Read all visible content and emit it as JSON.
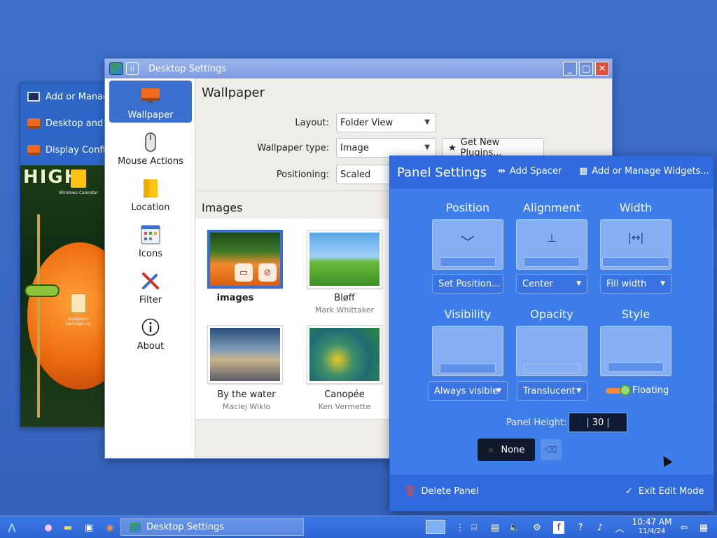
{
  "background_window": {
    "items": [
      {
        "label": "Add or Manage Widgets",
        "icon": "widgets-icon"
      },
      {
        "label": "Desktop and Wallpaper",
        "icon": "monitor-icon"
      },
      {
        "label": "Display Configuration",
        "icon": "monitor-icon"
      }
    ],
    "art_title": "HIGH",
    "desktop_icons": [
      {
        "label": "Windows Calendar"
      },
      {
        "label": "wallpaper package.zip"
      }
    ]
  },
  "desktop_settings": {
    "title": "Desktop Settings",
    "sidebar": [
      {
        "label": "Wallpaper",
        "icon": "monitor-icon",
        "active": true
      },
      {
        "label": "Mouse Actions",
        "icon": "mouse-icon"
      },
      {
        "label": "Location",
        "icon": "folder-icon"
      },
      {
        "label": "Icons",
        "icon": "icons-grid-icon"
      },
      {
        "label": "Filter",
        "icon": "tools-icon"
      },
      {
        "label": "About",
        "icon": "info-icon"
      }
    ],
    "heading": "Wallpaper",
    "layout_label": "Layout:",
    "layout_value": "Folder View",
    "wallpaper_type_label": "Wallpaper type:",
    "wallpaper_type_value": "Image",
    "get_plugins": "Get New Plugins...",
    "positioning_label": "Positioning:",
    "positioning_value": "Scaled",
    "images_title": "Images",
    "images": [
      {
        "name": "images",
        "author": ""
      },
      {
        "name": "Bløff",
        "author": "Mark Whittaker"
      },
      {
        "name": "By the water",
        "author": "Maciej Wiklo"
      },
      {
        "name": "Canopée",
        "author": "Ken Vermette"
      }
    ]
  },
  "panel_settings": {
    "title": "Panel Settings",
    "add_spacer": "Add Spacer",
    "add_widgets": "Add or Manage Widgets...",
    "position": {
      "title": "Position",
      "button": "Set Position..."
    },
    "alignment": {
      "title": "Alignment",
      "value": "Center"
    },
    "width": {
      "title": "Width",
      "value": "Fill width"
    },
    "visibility": {
      "title": "Visibility",
      "value": "Always visible"
    },
    "opacity": {
      "title": "Opacity",
      "value": "Translucent"
    },
    "style": {
      "title": "Style",
      "value": "Floating"
    },
    "height_label": "Panel Height:",
    "height_value": "30",
    "shortcut_value": "None",
    "delete_panel": "Delete Panel",
    "exit_edit": "Exit Edit Mode"
  },
  "taskbar": {
    "task_label": "Desktop Settings",
    "time": "10:47 AM",
    "date": "11/4/24"
  },
  "colors": {
    "accent": "#3a6fd0",
    "panel_bg": "#3d7eea",
    "taskbar": "#2d66d4",
    "close": "#e0503c"
  }
}
